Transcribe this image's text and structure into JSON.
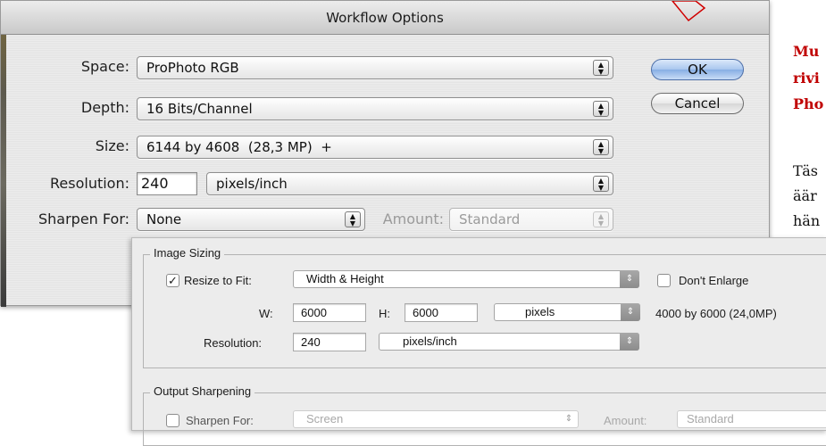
{
  "workflow": {
    "title": "Workflow Options",
    "space": {
      "label": "Space:",
      "value": "ProPhoto RGB"
    },
    "depth": {
      "label": "Depth:",
      "value": "16 Bits/Channel"
    },
    "size": {
      "label": "Size:",
      "value": "6144 by 4608  (28,3 MP)  +"
    },
    "resolution": {
      "label": "Resolution:",
      "value": "240",
      "unit": "pixels/inch"
    },
    "sharpen": {
      "label": "Sharpen For:",
      "value": "None",
      "amount_label": "Amount:",
      "amount_value": "Standard"
    },
    "ok_label": "OK",
    "cancel_label": "Cancel"
  },
  "doc_text": {
    "red_lines": [
      "Mu",
      "rivi",
      "Pho"
    ],
    "black_lines": [
      "Täs",
      "äär",
      "hän"
    ]
  },
  "image_sizing": {
    "group_title": "Image Sizing",
    "resize_label": "Resize to Fit:",
    "resize_checked": true,
    "resize_value": "Width & Height",
    "dont_enlarge_label": "Don't Enlarge",
    "w_label": "W:",
    "w_value": "6000",
    "h_label": "H:",
    "h_value": "6000",
    "unit_value": "pixels",
    "dimension_info": "4000 by 6000 (24,0MP)",
    "resolution_label": "Resolution:",
    "resolution_value": "240",
    "resolution_unit": "pixels/inch"
  },
  "output_sharpening": {
    "group_title": "Output Sharpening",
    "sharpen_label": "Sharpen For:",
    "sharpen_value": "Screen",
    "amount_label": "Amount:",
    "amount_value": "Standard"
  },
  "colors": {
    "accent_red": "#c00000",
    "default_button": "#87aee4"
  }
}
